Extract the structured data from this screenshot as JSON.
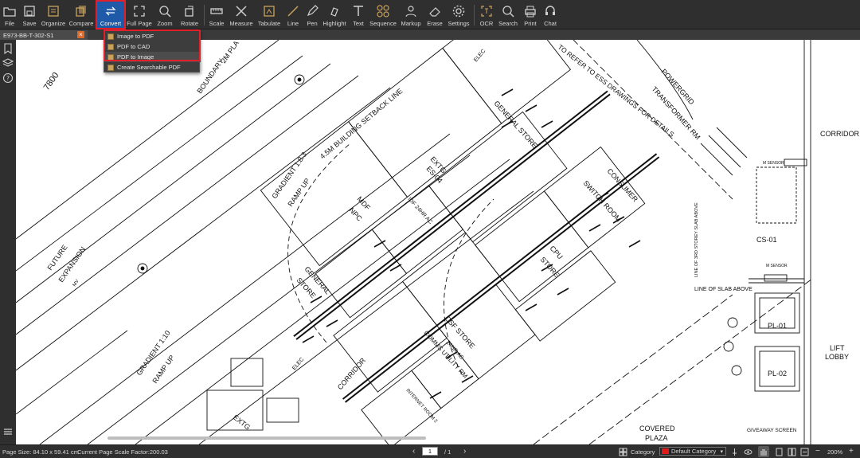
{
  "toolbar": {
    "items": [
      {
        "key": "file",
        "label": "File",
        "icon": "folder-icon"
      },
      {
        "key": "save",
        "label": "Save",
        "icon": "save-icon"
      },
      {
        "key": "organize",
        "label": "Organize",
        "icon": "organize-icon"
      },
      {
        "key": "compare",
        "label": "Compare",
        "icon": "compare-icon"
      },
      {
        "key": "convert",
        "label": "Convert",
        "icon": "convert-icon"
      },
      {
        "key": "fullpage",
        "label": "Full Page",
        "icon": "fullscreen-icon"
      },
      {
        "key": "zoom",
        "label": "Zoom",
        "icon": "zoom-icon"
      },
      {
        "key": "rotate",
        "label": "Rotate",
        "icon": "rotate-icon"
      },
      {
        "key": "scale",
        "label": "Scale",
        "icon": "ruler-icon"
      },
      {
        "key": "measure",
        "label": "Measure",
        "icon": "measure-icon"
      },
      {
        "key": "tabulate",
        "label": "Tabulate",
        "icon": "tabulate-icon"
      },
      {
        "key": "line",
        "label": "Line",
        "icon": "line-icon"
      },
      {
        "key": "pen",
        "label": "Pen",
        "icon": "pen-icon"
      },
      {
        "key": "highlight",
        "label": "Highlight",
        "icon": "highlight-icon"
      },
      {
        "key": "text",
        "label": "Text",
        "icon": "text-icon"
      },
      {
        "key": "sequence",
        "label": "Sequence",
        "icon": "sequence-icon"
      },
      {
        "key": "markup",
        "label": "Markup",
        "icon": "markup-icon"
      },
      {
        "key": "erase",
        "label": "Erase",
        "icon": "eraser-icon"
      },
      {
        "key": "settings",
        "label": "Settings",
        "icon": "gear-icon"
      },
      {
        "key": "ocr",
        "label": "OCR",
        "icon": "ocr-icon"
      },
      {
        "key": "search",
        "label": "Search",
        "icon": "search-icon"
      },
      {
        "key": "print",
        "label": "Print",
        "icon": "printer-icon"
      },
      {
        "key": "chat",
        "label": "Chat",
        "icon": "chat-icon"
      }
    ],
    "active": "Convert"
  },
  "tab": {
    "name": "E973-BB-T-302-S1",
    "close_icon": "close-icon"
  },
  "convert_menu": {
    "items": [
      "Image to PDF",
      "PDF to CAD",
      "PDF to Image",
      "Create Searchable PDF"
    ]
  },
  "drawing": {
    "labels": {
      "boundary": "BOUNDARY",
      "dim": "7800",
      "setback": "4.5M BUILDING SETBACK LINE",
      "plant": "2M PLA",
      "gradient1": "GRADIENT 1:8.3",
      "ramp1": "RAMP UP",
      "gradient2": "GRADIENT 1:10",
      "ramp2": "RAMP UP",
      "future": "FUTURE",
      "expansion": "EXPANSION",
      "mv1": "MV",
      "note": "TO REFER TO ESS DRAWINGS FOR DETAILS",
      "general_store_top": "GENERAL STORE",
      "powergrid": "POWERGRID",
      "transformer": "TRANSFORMER RM",
      "consumer": "CONSUMER",
      "switch_room": "SWITCH ROOM",
      "mdf": "MDF",
      "npc": "NPC",
      "idf": "IDF 24HR AC",
      "extg": "EXTG",
      "es": "ES-04",
      "general_store_mid": "GENERAL",
      "store": "STORE",
      "cpu": "CPU",
      "cpu_store": "STORE",
      "csf": "CSF STORE",
      "comms": "COMMS UTILITY RM",
      "ac24": "24HR AC",
      "corridor_mid": "CORRIDOR",
      "corridor_right": "CORRIDOR",
      "elec": "ELEC",
      "elec2": "ELEC",
      "cs": "CS-01",
      "m_sensor1": "M SENSOR",
      "m_sensor2": "M SENSOR",
      "line_slab": "LINE OF SLAB ABOVE",
      "line_3rd": "LINE OF 3RD STOREY SLAB ABOVE",
      "pl01": "PL-01",
      "pl02": "PL-02",
      "lift": "LIFT",
      "lobby": "LOBBY",
      "covered": "COVERED",
      "plaza": "PLAZA",
      "giveaway": "GIVEAWAY SCREEN",
      "extg_bottom": "EXTG",
      "internet": "INTERNET ROOM 2"
    }
  },
  "status": {
    "page_size": "Page Size: 84.10 x 59.41 cm",
    "scale": "Current Page Scale Factor:200.03",
    "page_current": "1",
    "page_total": "/ 1",
    "category_label": "Category",
    "category_value": "Default Category",
    "zoom": "200%",
    "colors": {
      "category": "#e01919",
      "active": "#1e5aa8",
      "outline": "#e0202a"
    }
  }
}
